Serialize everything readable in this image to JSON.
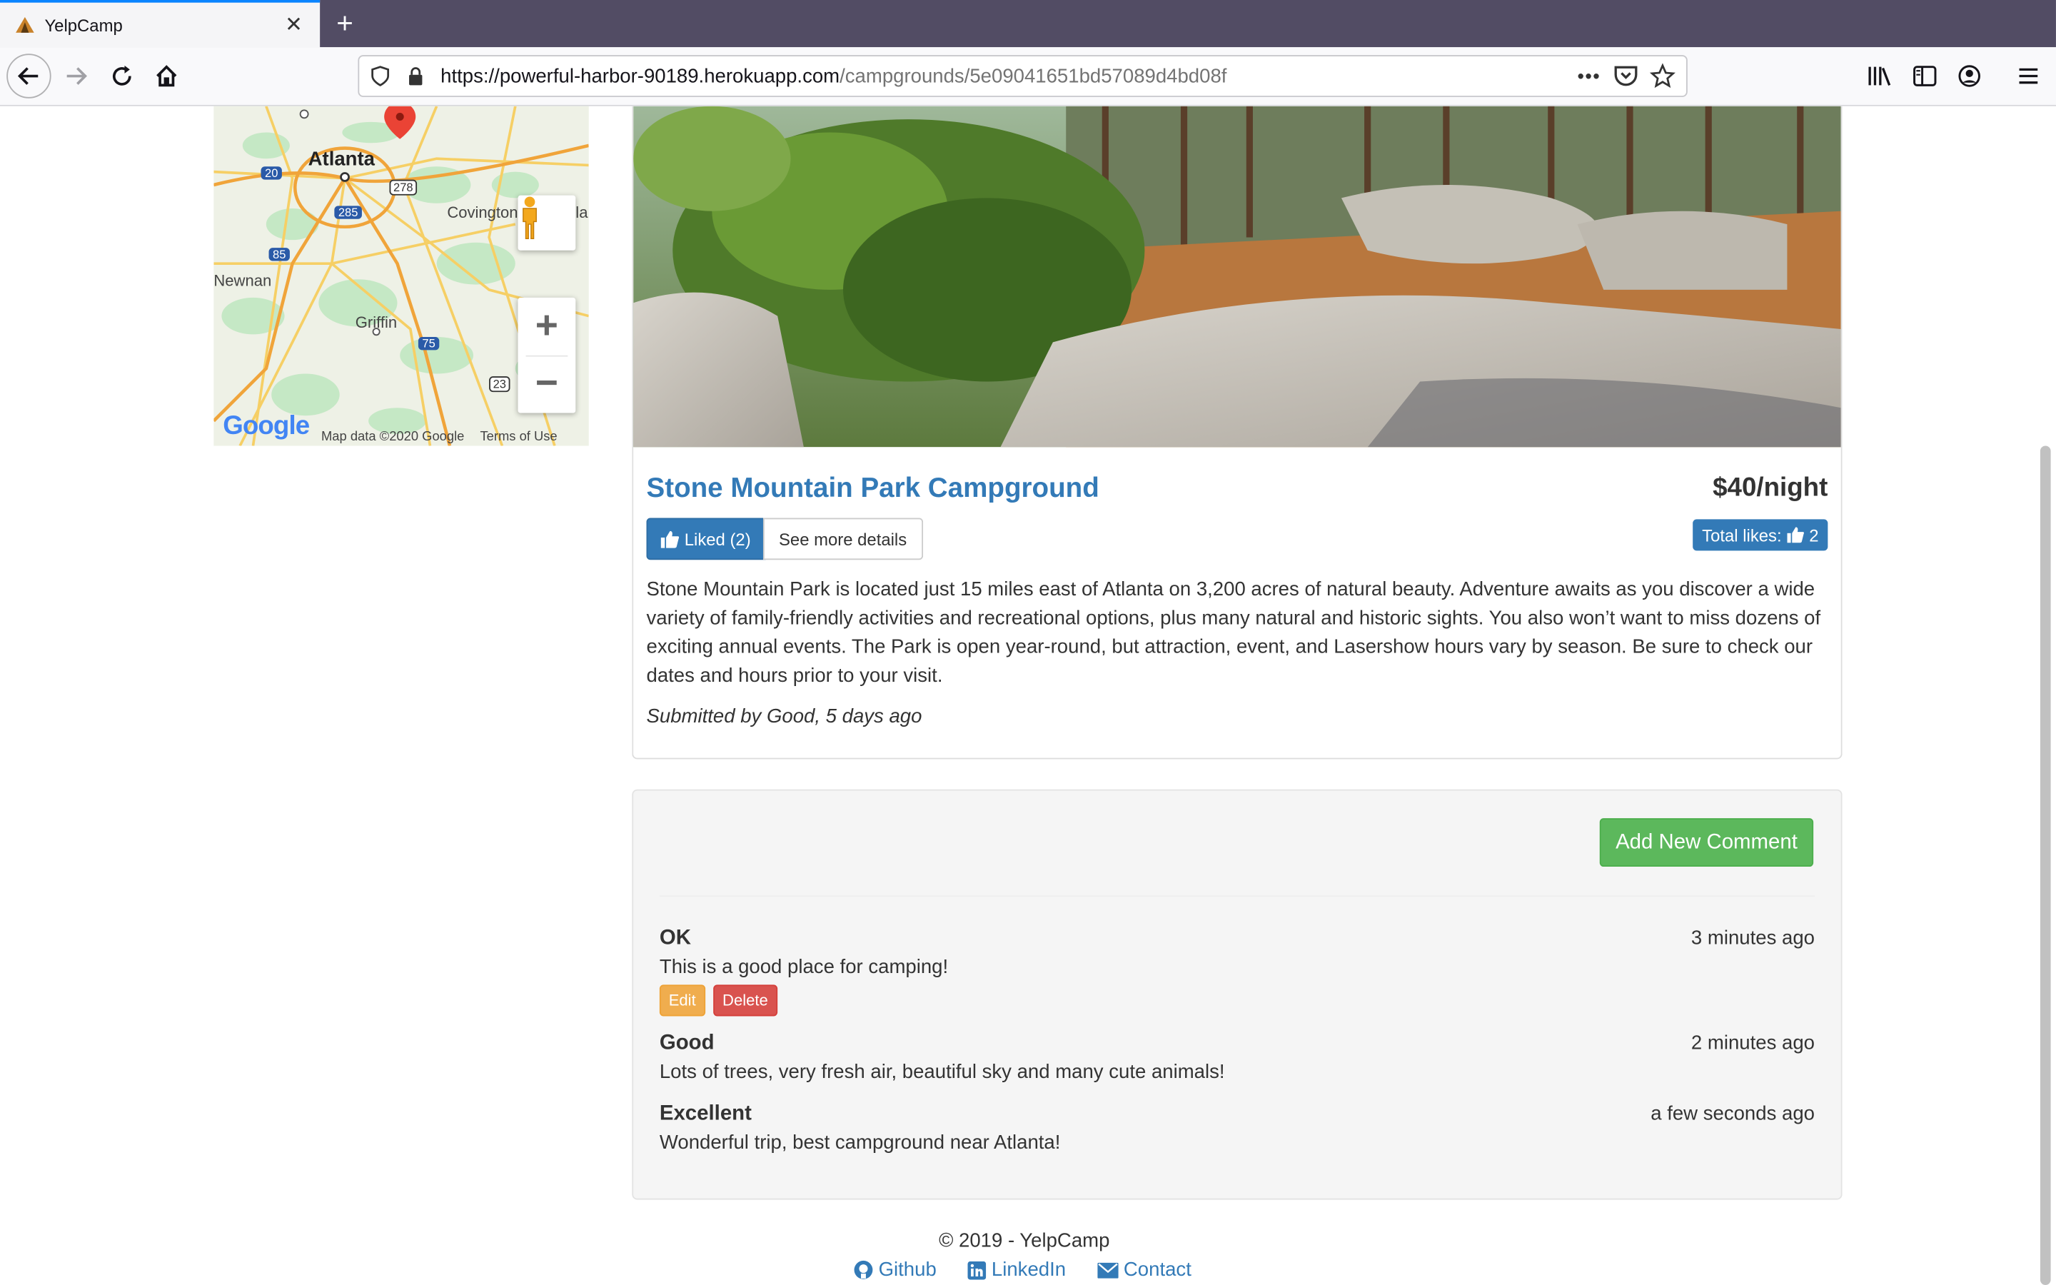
{
  "browser": {
    "tab_title": "YelpCamp",
    "new_tab_symbol": "+",
    "close_symbol": "✕",
    "url_host": "https://powerful-harbor-90189.herokuapp.com",
    "url_path": "/campgrounds/5e09041651bd57089d4bd08f",
    "page_actions": "•••"
  },
  "map": {
    "labels": {
      "atlanta": "Atlanta",
      "covington": "Covington",
      "newnan": "Newnan",
      "griffin": "Griffin",
      "la": "la"
    },
    "road_shields": [
      "20",
      "285",
      "278",
      "85",
      "75",
      "23"
    ],
    "zoom_in": "+",
    "zoom_out": "−",
    "google_logo": "Google",
    "attribution": "Map data ©2020 Google",
    "terms": "Terms of Use"
  },
  "campground": {
    "name": "Stone Mountain Park Campground",
    "price": "$40/night",
    "liked_label": "Liked (2)",
    "details_label": "See more details",
    "total_likes_label": "Total likes:",
    "total_likes_count": "2",
    "description": "Stone Mountain Park is located just 15 miles east of Atlanta on 3,200 acres of natural beauty. Adventure awaits as you discover a wide variety of family-friendly activities and recreational options, plus many natural and historic sights. You also won’t want to miss dozens of exciting annual events. The Park is open year-round, but attraction, event, and Lasershow hours vary by season. Be sure to check our dates and hours prior to your visit.",
    "submitted": "Submitted by Good, 5 days ago"
  },
  "comments_section": {
    "add_button": "Add New Comment",
    "comments": [
      {
        "author": "OK",
        "time": "3 minutes ago",
        "text": "This is a good place for camping!",
        "edit": "Edit",
        "delete": "Delete"
      },
      {
        "author": "Good",
        "time": "2 minutes ago",
        "text": "Lots of trees, very fresh air, beautiful sky and many cute animals!"
      },
      {
        "author": "Excellent",
        "time": "a few seconds ago",
        "text": "Wonderful trip, best campground near Atlanta!"
      }
    ]
  },
  "footer": {
    "copyright": "© 2019 - YelpCamp",
    "links": [
      "Github",
      "LinkedIn",
      "Contact"
    ]
  },
  "colors": {
    "primary": "#337ab7",
    "success": "#5cb85c",
    "warning": "#f0ad4e",
    "danger": "#d9534f"
  }
}
